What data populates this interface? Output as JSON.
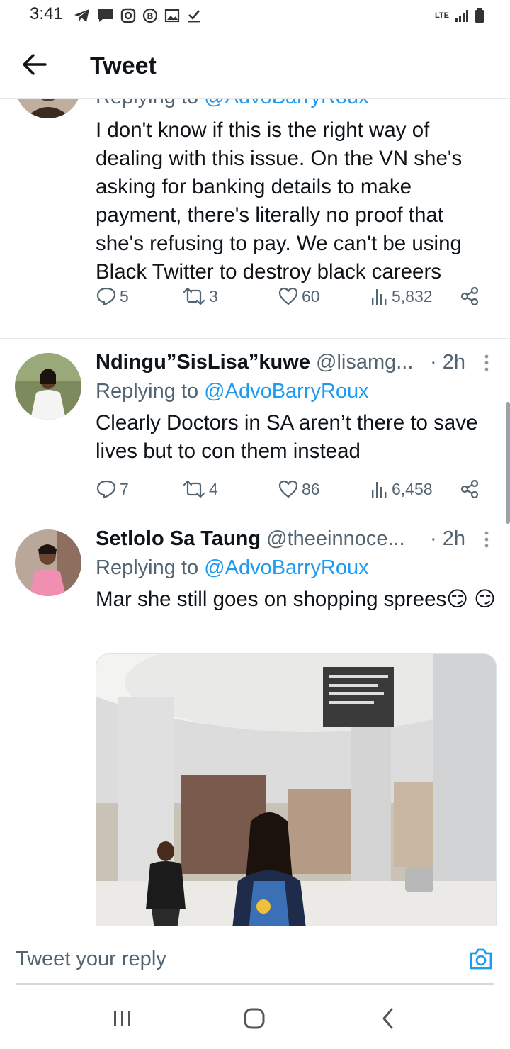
{
  "status_bar": {
    "time": "3:41",
    "network": "LTE"
  },
  "header": {
    "title": "Tweet"
  },
  "tweets": [
    {
      "replying_prefix": "Replying to ",
      "replying_to": "@AdvoBarryRoux",
      "text": "I don't know if this is the right way of dealing with this issue. On the VN she's asking for banking details to make payment, there's literally no proof that she's refusing to pay. We can't be using Black Twitter to destroy black careers",
      "stats": {
        "replies": "5",
        "retweets": "3",
        "likes": "60",
        "views": "5,832"
      }
    },
    {
      "name": "Ndingu”SisLisa”kuwe",
      "handle": "@lisamg...",
      "time": "· 2h",
      "replying_prefix": "Replying to ",
      "replying_to": "@AdvoBarryRoux",
      "text": "Clearly Doctors in SA aren’t there to save lives but to con them instead",
      "stats": {
        "replies": "7",
        "retweets": "4",
        "likes": "86",
        "views": "6,458"
      }
    },
    {
      "name": "Setlolo Sa Taung",
      "handle": "@theeinnoce...",
      "time": "· 2h",
      "replying_prefix": "Replying to ",
      "replying_to": "@AdvoBarryRoux",
      "text": "Mar she still goes on shopping sprees😏 😏"
    }
  ],
  "reply_box": {
    "placeholder": "Tweet your reply"
  },
  "colors": {
    "accent": "#1d9bf0",
    "muted": "#536471",
    "text": "#0f1419"
  },
  "icons": [
    "back-arrow-icon",
    "reply-icon",
    "retweet-icon",
    "like-icon",
    "views-icon",
    "share-icon",
    "more-icon",
    "camera-icon"
  ]
}
